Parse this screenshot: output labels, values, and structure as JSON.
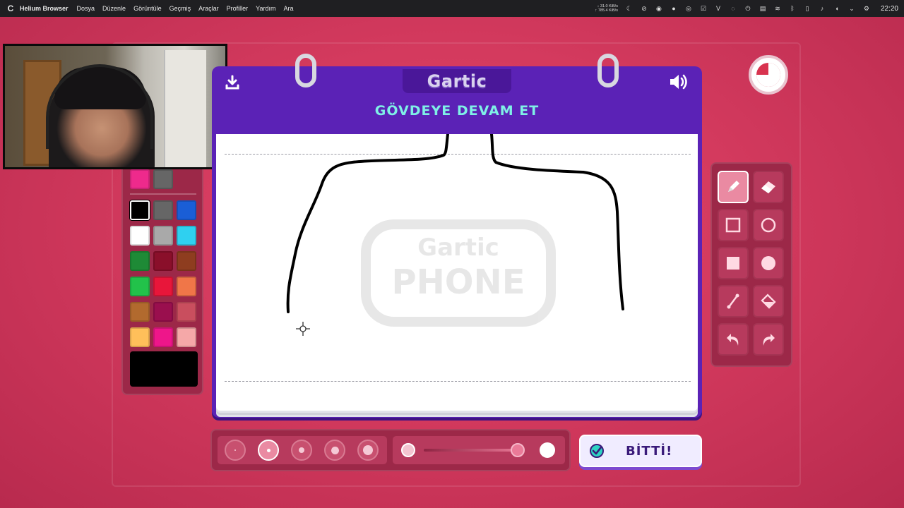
{
  "menubar": {
    "app_name": "Helium Browser",
    "items": [
      "Dosya",
      "Düzenle",
      "Görüntüle",
      "Geçmiş",
      "Araçlar",
      "Profiller",
      "Yardım",
      "Ara"
    ],
    "net_down": "↓ 31.0 KiB/s",
    "net_up": "↑ 785.4 KiB/s",
    "clock": "22:20"
  },
  "game": {
    "brand": "Gartic",
    "prompt": "GÖVDEYE DEVAM ET",
    "watermark_top": "Gartic",
    "watermark_bottom": "PHONE",
    "done_label": "BİTTİ!",
    "timer_fraction_elapsed": 0.75
  },
  "palette": {
    "top_colors": [
      "#ee2a8c",
      "#666666"
    ],
    "colors": [
      [
        "#000000",
        "#666666",
        "#1a5ed6"
      ],
      [
        "#ffffff",
        "#a9a9a9",
        "#2fd0f0"
      ],
      [
        "#1e8a36",
        "#8a0f2a",
        "#8e3d1f"
      ],
      [
        "#22c24a",
        "#e8163a",
        "#f07648"
      ],
      [
        "#b26a2e",
        "#9a0f4e",
        "#c94e5e"
      ],
      [
        "#ffbf5a",
        "#ee168a",
        "#f5a8a8"
      ]
    ],
    "selected_color": "#000000"
  },
  "tools": [
    {
      "name": "pencil-icon",
      "active": true
    },
    {
      "name": "eraser-icon",
      "active": false
    },
    {
      "name": "rectangle-outline-icon",
      "active": false
    },
    {
      "name": "circle-outline-icon",
      "active": false
    },
    {
      "name": "rectangle-filled-icon",
      "active": false
    },
    {
      "name": "circle-filled-icon",
      "active": false
    },
    {
      "name": "line-icon",
      "active": false
    },
    {
      "name": "fill-bucket-icon",
      "active": false
    },
    {
      "name": "undo-icon",
      "active": false
    },
    {
      "name": "redo-icon",
      "active": false
    }
  ],
  "brush": {
    "sizes": 5,
    "selected_size_index": 1,
    "opacity_fraction": 0.95
  }
}
